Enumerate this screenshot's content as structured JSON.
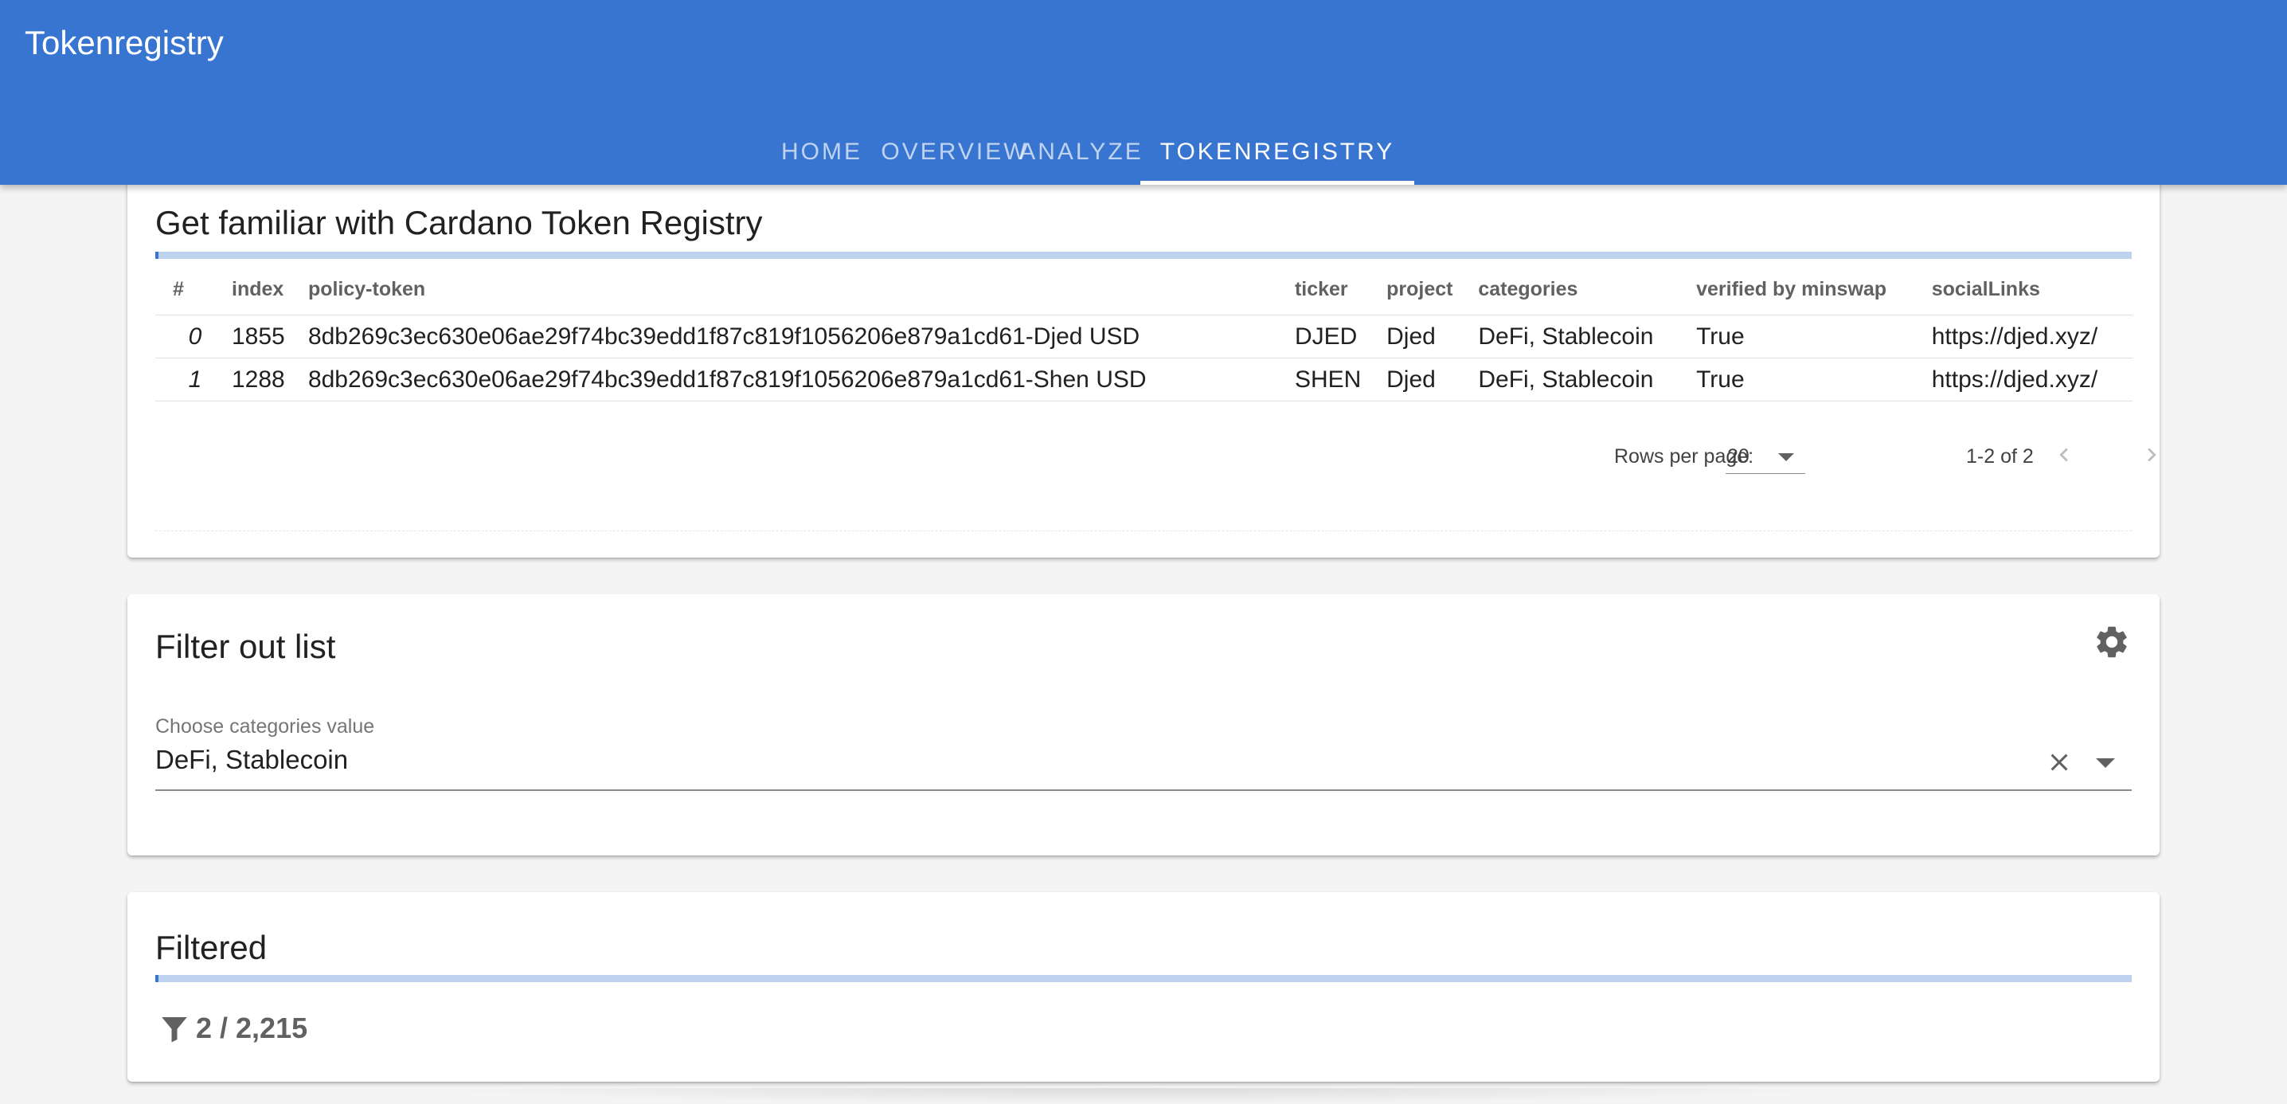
{
  "app": {
    "title": "Tokenregistry",
    "tabs": [
      "HOME",
      "OVERVIEW",
      "ANALYZE",
      "TOKENREGISTRY"
    ],
    "active_tab": "TOKENREGISTRY",
    "brand_color": "#3875d0"
  },
  "registry_card": {
    "title": "Get familiar with Cardano Token Registry",
    "columns": [
      "#",
      "index",
      "policy-token",
      "ticker",
      "project",
      "categories",
      "verified by minswap",
      "socialLinks"
    ],
    "rows": [
      [
        "0",
        "1855",
        "8db269c3ec630e06ae29f74bc39edd1f87c819f1056206e879a1cd61-Djed USD",
        "DJED",
        "Djed",
        "DeFi, Stablecoin",
        "True",
        "https://djed.xyz/"
      ],
      [
        "1",
        "1288",
        "8db269c3ec630e06ae29f74bc39edd1f87c819f1056206e879a1cd61-Shen USD",
        "SHEN",
        "Djed",
        "DeFi, Stablecoin",
        "True",
        "https://djed.xyz/"
      ]
    ],
    "pagination": {
      "rows_per_page_label": "Rows per page:",
      "rows_per_page": "20",
      "range": "1-2 of 2",
      "prev_icon": "chevron-left-icon",
      "next_icon": "chevron-right-icon"
    }
  },
  "filter_card": {
    "title": "Filter out list",
    "settings_icon": "gear-icon",
    "field_label": "Choose categories value",
    "field_value": "DeFi, Stablecoin",
    "clear_icon": "close-icon",
    "dropdown_icon": "caret-down-icon"
  },
  "filtered_card": {
    "title": "Filtered",
    "icon": "filter-icon",
    "count": "2 / 2,215"
  }
}
